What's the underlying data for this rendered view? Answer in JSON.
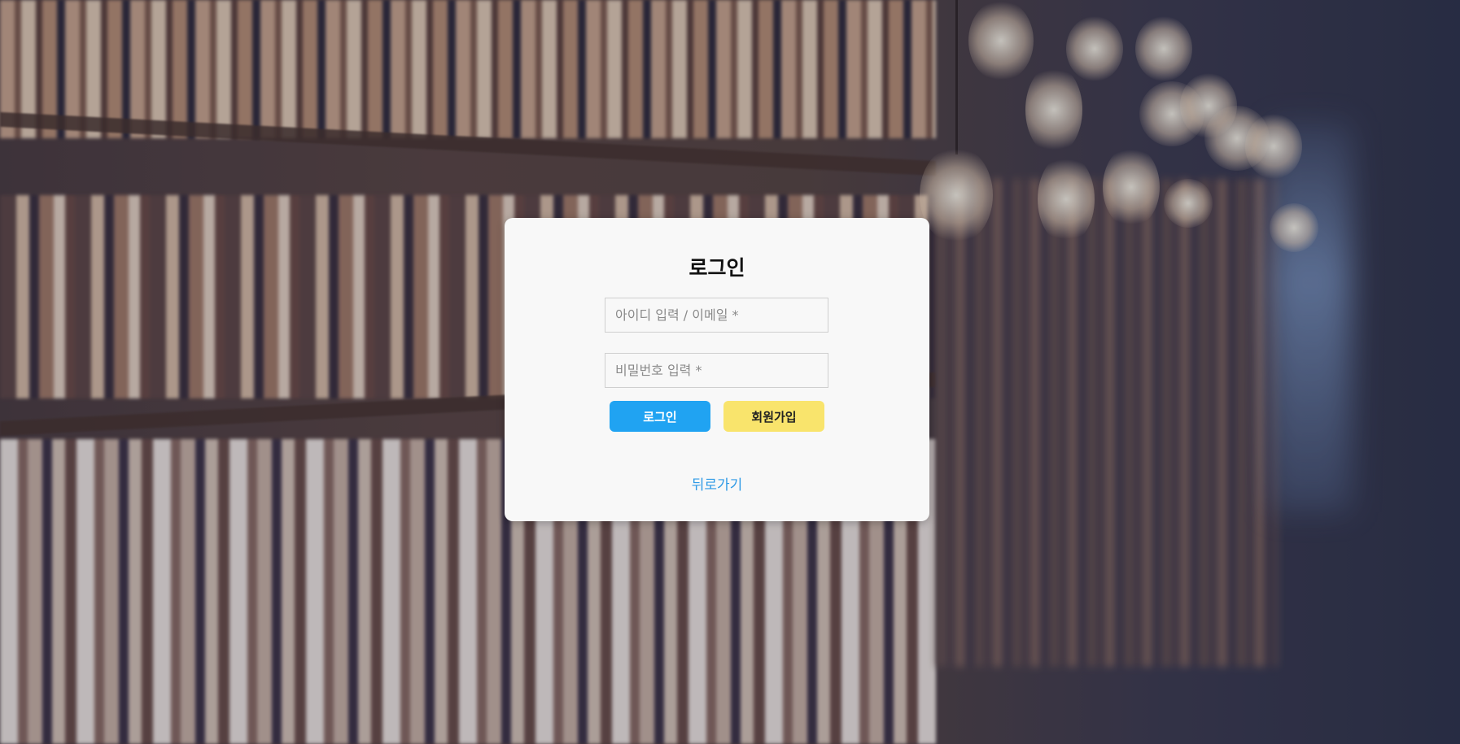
{
  "login": {
    "title": "로그인",
    "id_placeholder": "아이디 입력 / 이메일 *",
    "password_placeholder": "비밀번호 입력 *",
    "login_button": "로그인",
    "signup_button": "회원가입",
    "back_link": "뒤로가기"
  },
  "colors": {
    "login_button": "#20a3f2",
    "signup_button": "#f9e46c",
    "link": "#2e9ae6",
    "card": "#f8f8f8"
  }
}
